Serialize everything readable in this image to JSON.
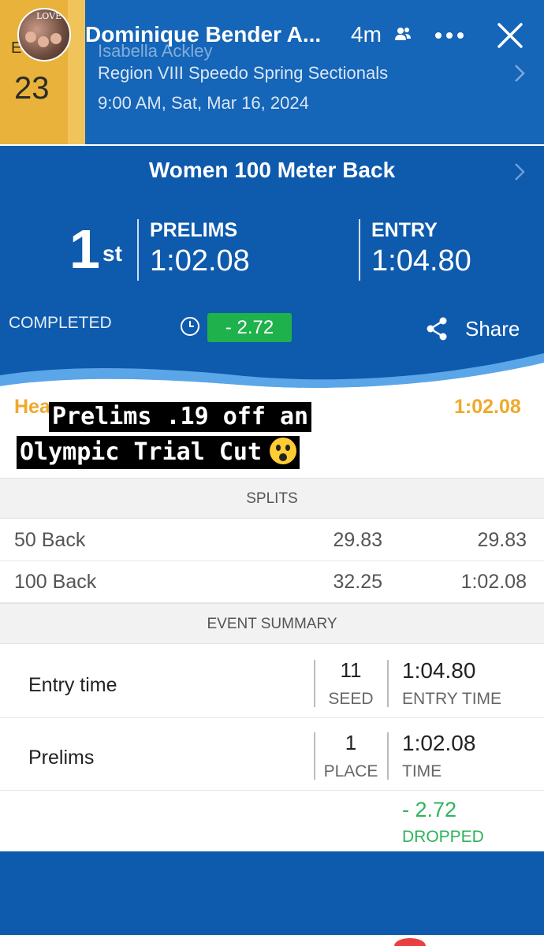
{
  "story": {
    "user": "Dominique Bender A...",
    "time": "4m",
    "avatar_text": "LOVE"
  },
  "event": {
    "label": "E",
    "number": "23",
    "athlete": "Isabella Ackley",
    "meet": "Region VIII Speedo Spring Sectionals",
    "datetime": "9:00 AM, Sat, Mar 16, 2024",
    "title": "Women 100 Meter Back"
  },
  "result": {
    "place": "1",
    "place_suffix": "st",
    "prelims_label": "PRELIMS",
    "prelims_time": "1:02.08",
    "entry_label": "ENTRY",
    "entry_time": "1:04.80",
    "status": "COMPLETED",
    "diff": "- 2.72",
    "share_label": "Share"
  },
  "heat": {
    "label": "Hea",
    "time": "1:02.08"
  },
  "caption": {
    "line1": "Prelims .19 off an",
    "line2": "Olympic Trial Cut"
  },
  "splits": {
    "header": "SPLITS",
    "rows": [
      {
        "name": "50 Back",
        "split": "29.83",
        "cumulative": "29.83"
      },
      {
        "name": "100 Back",
        "split": "32.25",
        "cumulative": "1:02.08"
      }
    ]
  },
  "summary": {
    "header": "EVENT SUMMARY",
    "rows": [
      {
        "label": "Entry time",
        "val1": "11",
        "cap1": "SEED",
        "val2": "1:04.80",
        "cap2": "ENTRY TIME"
      },
      {
        "label": "Prelims",
        "val1": "1",
        "cap1": "PLACE",
        "val2": "1:02.08",
        "cap2": "TIME"
      }
    ],
    "dropped_value": "- 2.72",
    "dropped_label": "DROPPED"
  },
  "colors": {
    "primary_blue": "#0e5aad",
    "header_blue": "#1565b8",
    "accent_gold": "#efa92a",
    "badge_green": "#1fb14b",
    "drop_green": "#2fb35c"
  },
  "icons": {
    "group": "people-icon",
    "menu": "more-icon",
    "close": "close-icon",
    "clock": "clock-icon",
    "share": "share-icon",
    "chevron": "chevron-right-icon",
    "emoji": "face-screaming-in-fear-emoji"
  }
}
